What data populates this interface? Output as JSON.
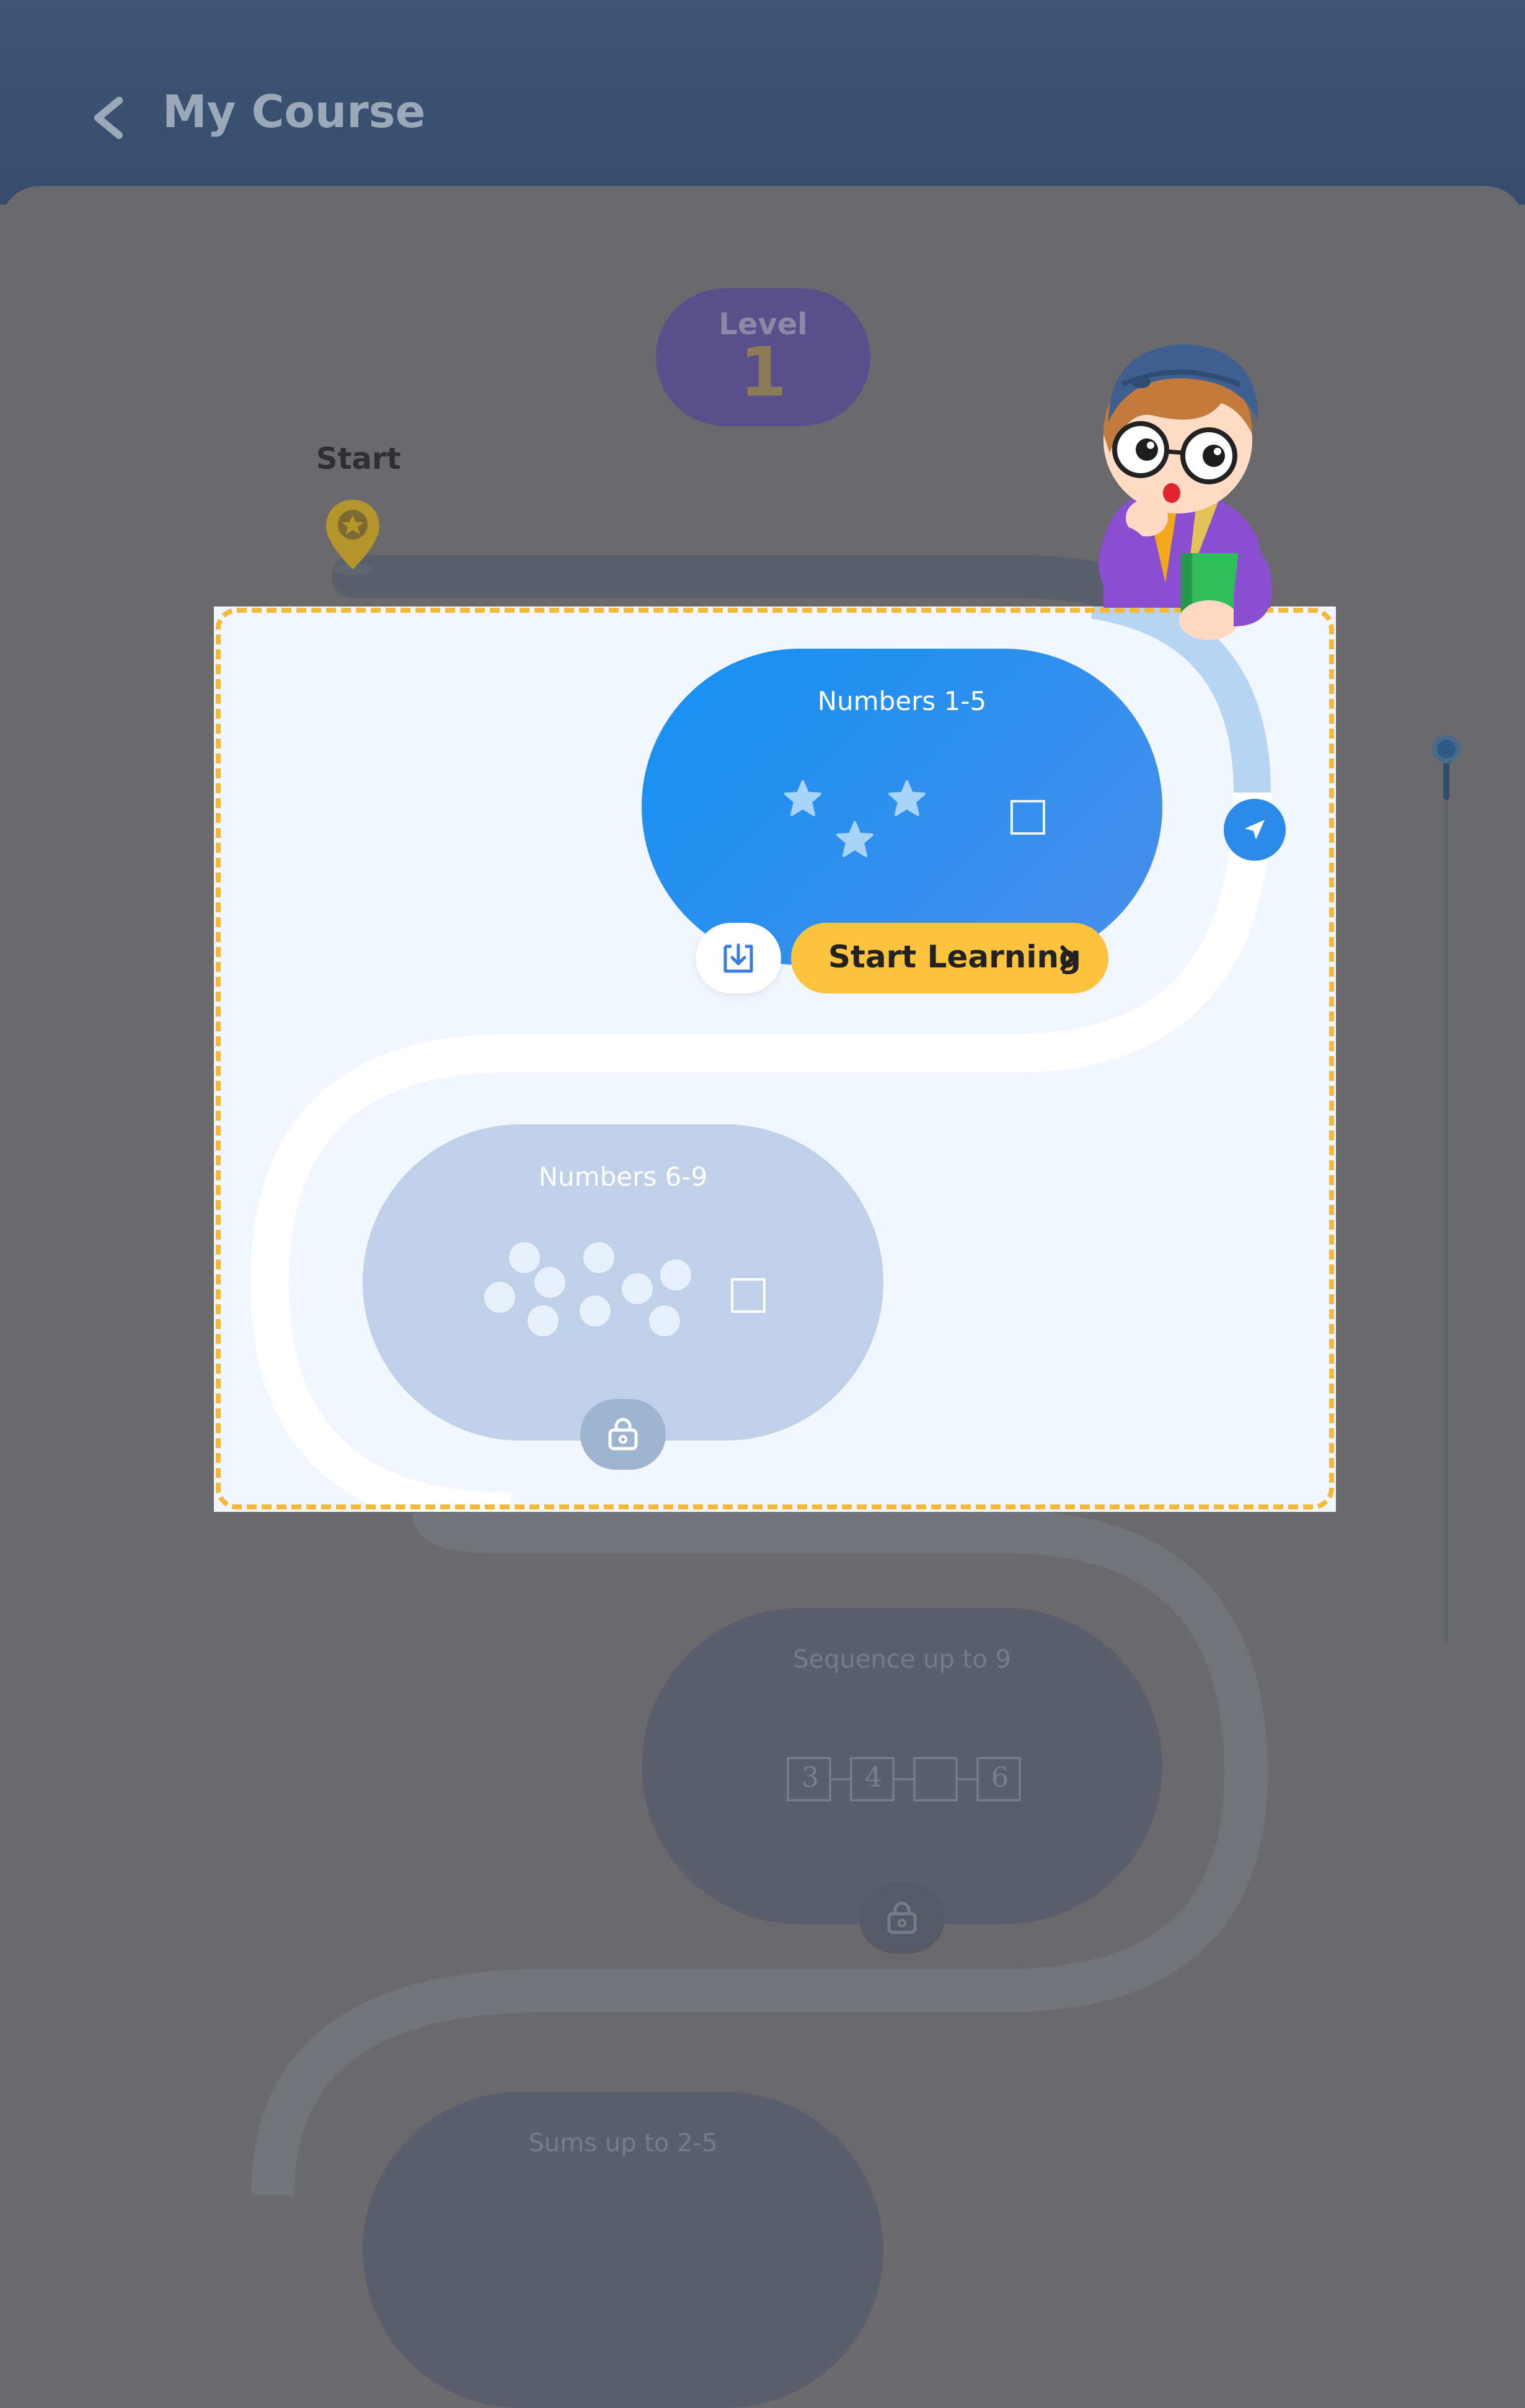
{
  "header": {
    "title": "My Course",
    "back_icon": "chevron-left-icon"
  },
  "level": {
    "label": "Level",
    "number": "1"
  },
  "start": {
    "label": "Start",
    "icon": "location-pin-star-icon"
  },
  "lessons": [
    {
      "title": "Numbers 1-5",
      "state": "active",
      "action_label": "Start Learning",
      "download_icon": "download-icon",
      "nav_icon": "navigation-arrow-icon"
    },
    {
      "title": "Numbers 6-9",
      "state": "locked",
      "lock_icon": "lock-icon"
    },
    {
      "title": "Sequence up to 9",
      "state": "locked",
      "sequence": [
        "3",
        "4",
        "",
        "6"
      ]
    },
    {
      "title": "Sums up to 2-5",
      "state": "locked"
    }
  ],
  "colors": {
    "header": "#3f5677",
    "overlay": "#6a6a6d",
    "panel": "#f1f6ff",
    "active_card": "#1391f3",
    "start_button": "#fbc33e",
    "locked_card": "#c0d0e8",
    "highlight_border": "#f5b93a"
  }
}
